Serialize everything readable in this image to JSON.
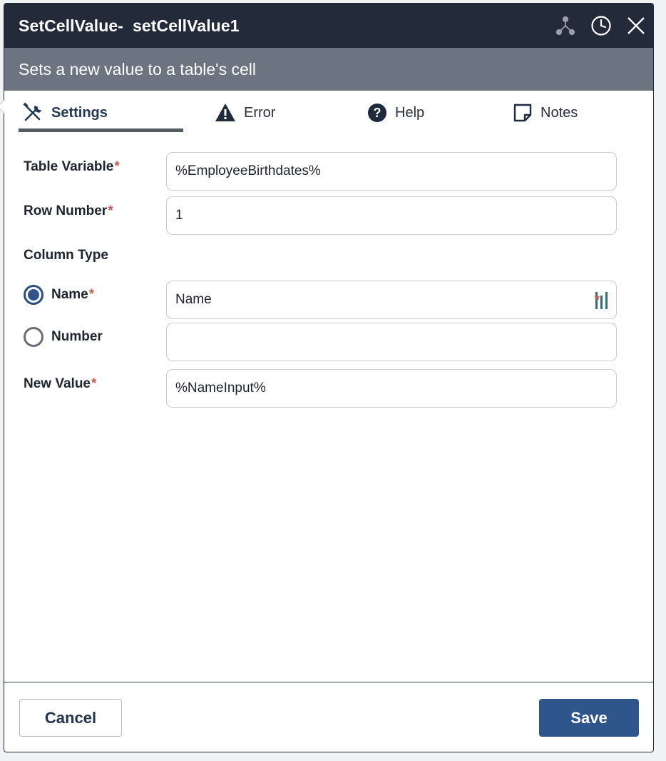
{
  "window": {
    "title": "SetCellValue-  setCellValue1",
    "subtitle": "Sets a new value to a table's cell",
    "icons": [
      "hierarchy-icon",
      "clock-icon",
      "close-icon"
    ]
  },
  "tabs": [
    {
      "label": "Settings",
      "icon": "tools-icon",
      "active": true
    },
    {
      "label": "Error",
      "icon": "warning-icon",
      "active": false
    },
    {
      "label": "Help",
      "icon": "question-circle-icon",
      "active": false
    },
    {
      "label": "Notes",
      "icon": "note-icon",
      "active": false
    }
  ],
  "form": {
    "table_variable": {
      "label": "Table Variable",
      "required_mark": "*",
      "value": "%EmployeeBirthdates%"
    },
    "row_number": {
      "label": "Row Number",
      "required_mark": "*",
      "value": "1"
    },
    "column_type": {
      "label": "Column Type"
    },
    "name_option": {
      "label": "Name",
      "required_mark": "*",
      "value": "Name",
      "selected": true
    },
    "number_option": {
      "label": "Number",
      "value": "",
      "selected": false
    },
    "new_value": {
      "label": "New Value",
      "required_mark": "*",
      "value": "%NameInput%"
    }
  },
  "footer": {
    "cancel_label": "Cancel",
    "save_label": "Save"
  },
  "colors": {
    "titlebar": "#232b3b",
    "subtitle_bar": "#6c7482",
    "accent": "#2f568c",
    "required": "#c45b4f"
  }
}
